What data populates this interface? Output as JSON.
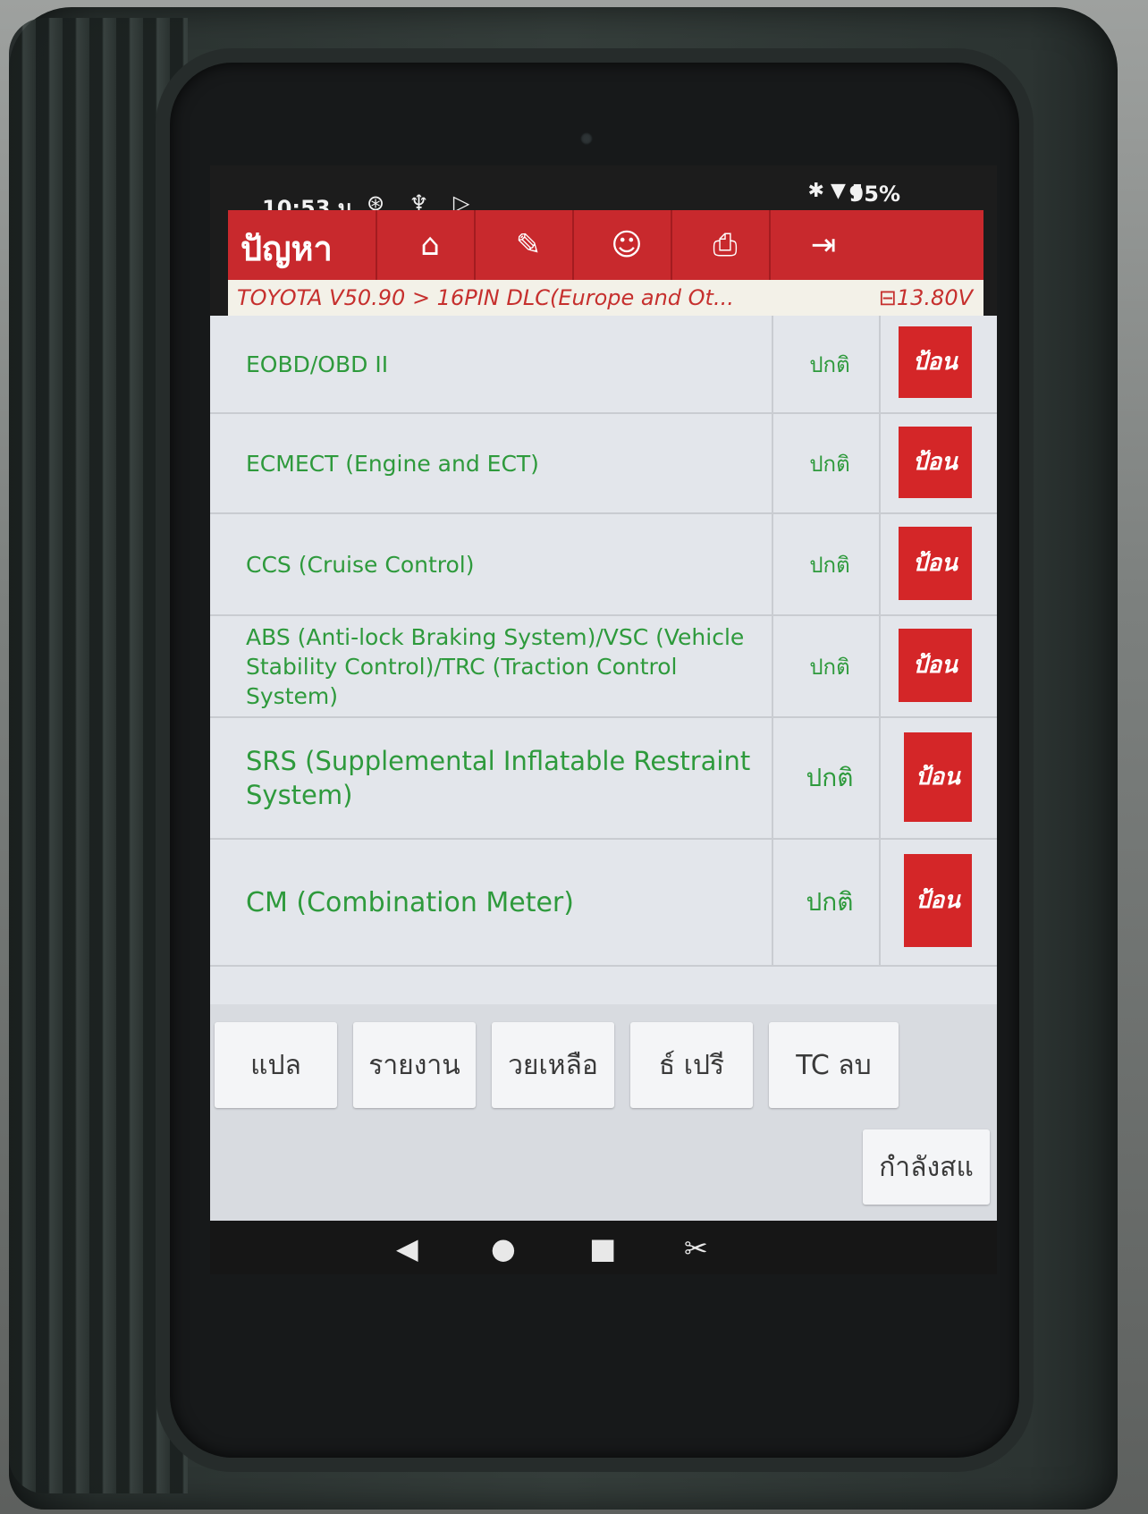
{
  "status_bar": {
    "time": "10:53 น.",
    "left_icons": "⊛ ♆ ▷",
    "right_icons": "✱ ▼ ▮",
    "battery": "95%"
  },
  "header": {
    "title": "ปัญหา",
    "toolbar": [
      {
        "icon": "home-icon",
        "glyph": "⌂"
      },
      {
        "icon": "edit-icon",
        "glyph": "✎"
      },
      {
        "icon": "support-icon",
        "glyph": "☺"
      },
      {
        "icon": "print-icon",
        "glyph": "⎙"
      },
      {
        "icon": "exit-icon",
        "glyph": "⇥"
      }
    ]
  },
  "breadcrumb": {
    "path": "TOYOTA V50.90 > 16PIN DLC(Europe and Ot...",
    "voltage": "13.80V"
  },
  "systems": [
    {
      "name": "EOBD/OBD II",
      "status": "ปกติ",
      "action": "ป้อน"
    },
    {
      "name": "ECMECT (Engine and ECT)",
      "status": "ปกติ",
      "action": "ป้อน"
    },
    {
      "name": "CCS (Cruise Control)",
      "status": "ปกติ",
      "action": "ป้อน"
    },
    {
      "name": "ABS (Anti-lock Braking System)/VSC (Vehicle Stability Control)/TRC (Traction Control System)",
      "status": "ปกติ",
      "action": "ป้อน"
    },
    {
      "name": "SRS (Supplemental Inflatable Restraint System)",
      "status": "ปกติ",
      "action": "ป้อน"
    },
    {
      "name": "CM (Combination Meter)",
      "status": "ปกติ",
      "action": "ป้อน"
    }
  ],
  "bottom_buttons": [
    "แปล",
    "รายงาน",
    "วยเหลือ",
    "ธ์   เปรี",
    "TC    ลบ"
  ],
  "scan_button": "กำลังสแ",
  "nav": {
    "back": "◀",
    "home": "●",
    "recents": "■",
    "screenshot": "✂"
  },
  "colors": {
    "accent": "#c8292d",
    "status_text": "#2e9a3c"
  }
}
